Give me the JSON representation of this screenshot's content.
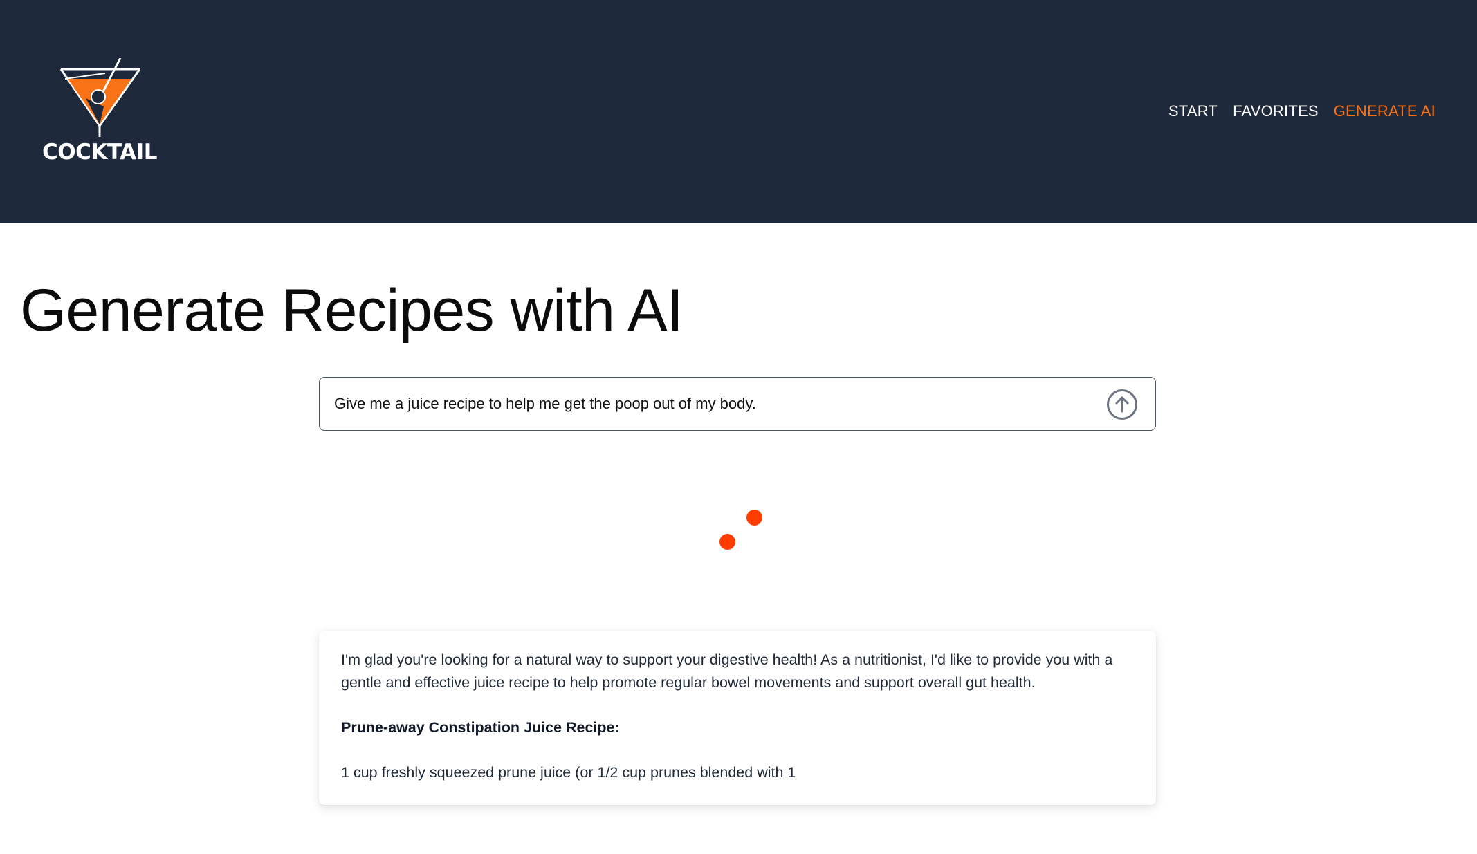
{
  "header": {
    "logo_text": "COCKTAIL",
    "background": "#1e293b",
    "accent": "#f97316"
  },
  "nav": {
    "items": [
      {
        "label": "START",
        "active": false
      },
      {
        "label": "FAVORITES",
        "active": false
      },
      {
        "label": "GENERATE AI",
        "active": true
      }
    ]
  },
  "main": {
    "title": "Generate Recipes with AI",
    "prompt": {
      "value": "Give me a juice recipe to help me get the poop out of my body."
    },
    "send_icon": "arrow-up-circle-icon",
    "loading_color": "#ff3d00",
    "response": {
      "intro": "I'm glad you're looking for a natural way to support your digestive health! As a nutritionist, I'd like to provide you with a gentle and effective juice recipe to help promote regular bowel movements and support overall gut health.",
      "heading": "Prune-away Constipation Juice Recipe:",
      "first_line": "1 cup freshly squeezed prune juice (or 1/2 cup prunes blended with 1"
    }
  }
}
